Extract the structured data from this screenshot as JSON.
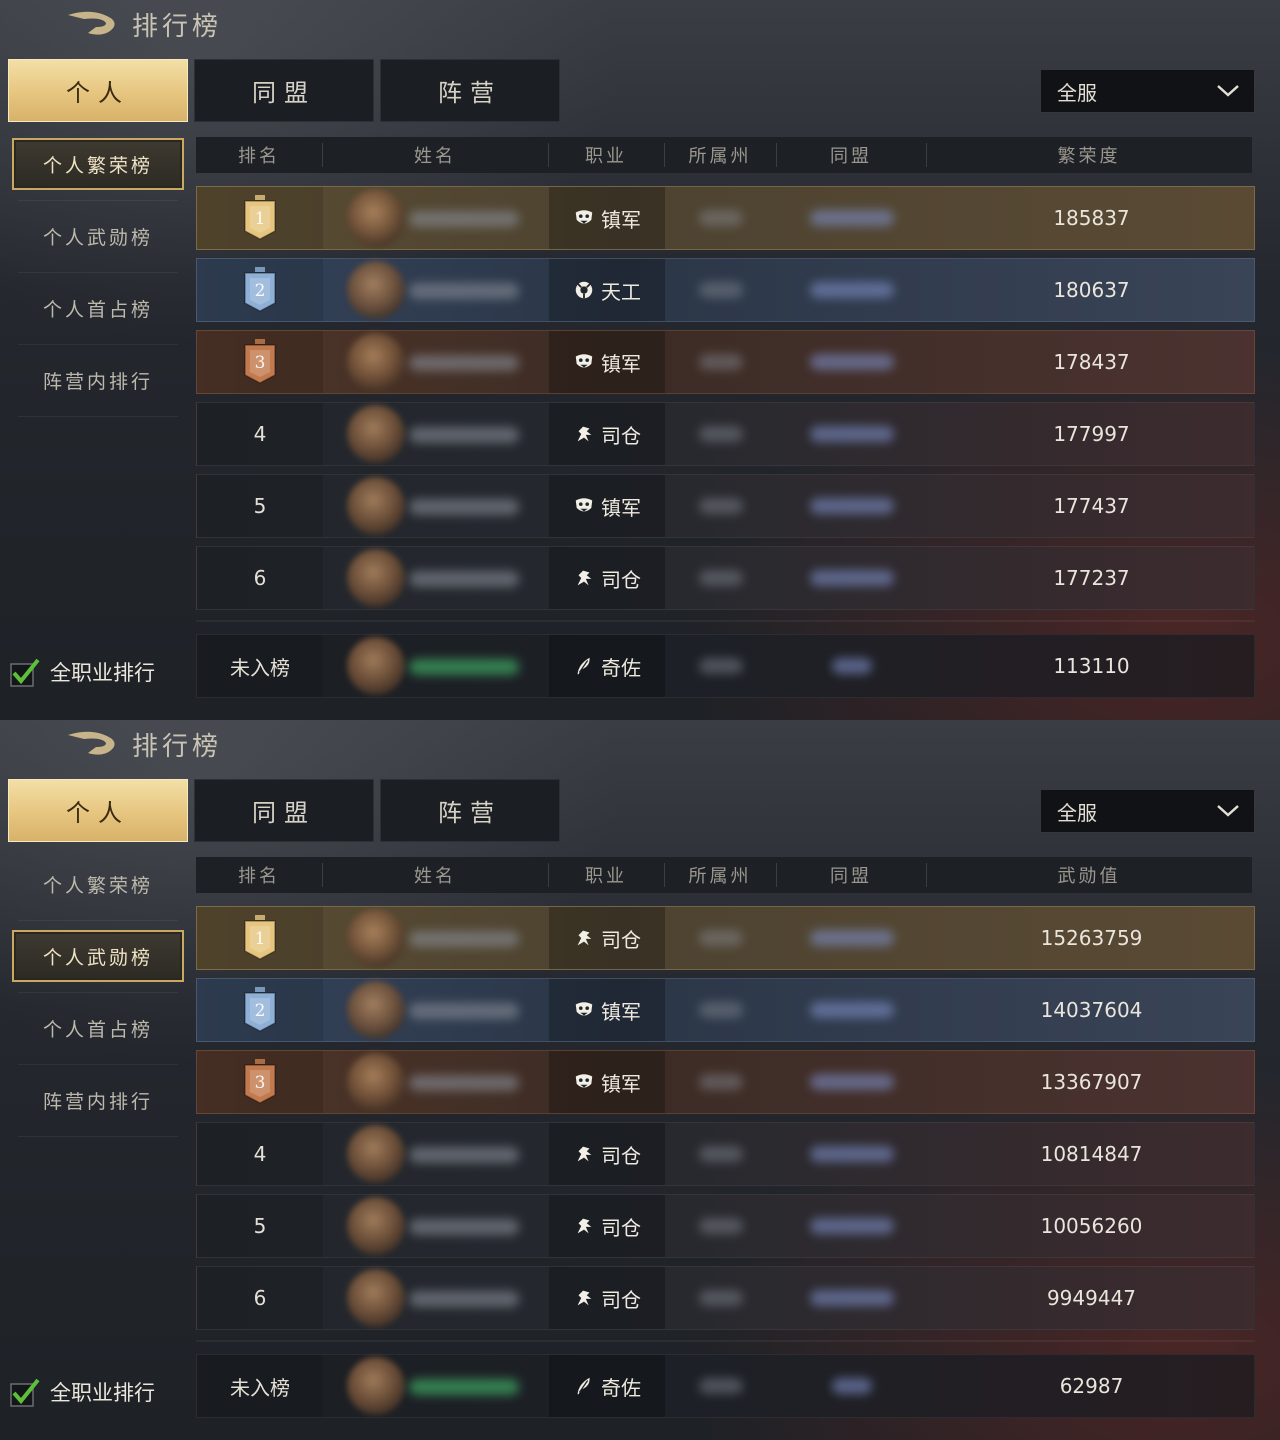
{
  "panels": [
    {
      "title": "排行榜",
      "tabs": [
        "个人",
        "同盟",
        "阵营"
      ],
      "server": "全服",
      "side_items": [
        "个人繁荣榜",
        "个人武勋榜",
        "个人首占榜",
        "阵营内排行"
      ],
      "active_side": 0,
      "checkbox_label": "全职业排行",
      "columns": [
        "排名",
        "姓名",
        "职业",
        "所属州",
        "同盟",
        "繁荣度"
      ],
      "rows": [
        {
          "rank": "1",
          "job": "镇军",
          "job_icon": "mask-icon",
          "value": "185837"
        },
        {
          "rank": "2",
          "job": "天工",
          "job_icon": "gear-mask-icon",
          "value": "180637"
        },
        {
          "rank": "3",
          "job": "镇军",
          "job_icon": "mask-icon",
          "value": "178437"
        },
        {
          "rank": "4",
          "job": "司仓",
          "job_icon": "horse-icon",
          "value": "177997"
        },
        {
          "rank": "5",
          "job": "镇军",
          "job_icon": "mask-icon",
          "value": "177437"
        },
        {
          "rank": "6",
          "job": "司仓",
          "job_icon": "horse-icon",
          "value": "177237"
        }
      ],
      "my_row": {
        "rank": "未入榜",
        "job": "奇佐",
        "job_icon": "feather-icon",
        "value": "113110"
      }
    },
    {
      "title": "排行榜",
      "tabs": [
        "个人",
        "同盟",
        "阵营"
      ],
      "server": "全服",
      "side_items": [
        "个人繁荣榜",
        "个人武勋榜",
        "个人首占榜",
        "阵营内排行"
      ],
      "active_side": 1,
      "checkbox_label": "全职业排行",
      "columns": [
        "排名",
        "姓名",
        "职业",
        "所属州",
        "同盟",
        "武勋值"
      ],
      "rows": [
        {
          "rank": "1",
          "job": "司仓",
          "job_icon": "horse-icon",
          "value": "15263759"
        },
        {
          "rank": "2",
          "job": "镇军",
          "job_icon": "mask-icon",
          "value": "14037604"
        },
        {
          "rank": "3",
          "job": "镇军",
          "job_icon": "mask-icon",
          "value": "13367907"
        },
        {
          "rank": "4",
          "job": "司仓",
          "job_icon": "horse-icon",
          "value": "10814847"
        },
        {
          "rank": "5",
          "job": "司仓",
          "job_icon": "horse-icon",
          "value": "10056260"
        },
        {
          "rank": "6",
          "job": "司仓",
          "job_icon": "horse-icon",
          "value": "9949447"
        }
      ],
      "my_row": {
        "rank": "未入榜",
        "job": "奇佐",
        "job_icon": "feather-icon",
        "value": "62987"
      }
    }
  ],
  "colors": {
    "gold": "#e6c57f",
    "silver": "#8fb0d6",
    "bronze": "#c27a4e",
    "check": "#5fbf3a"
  }
}
